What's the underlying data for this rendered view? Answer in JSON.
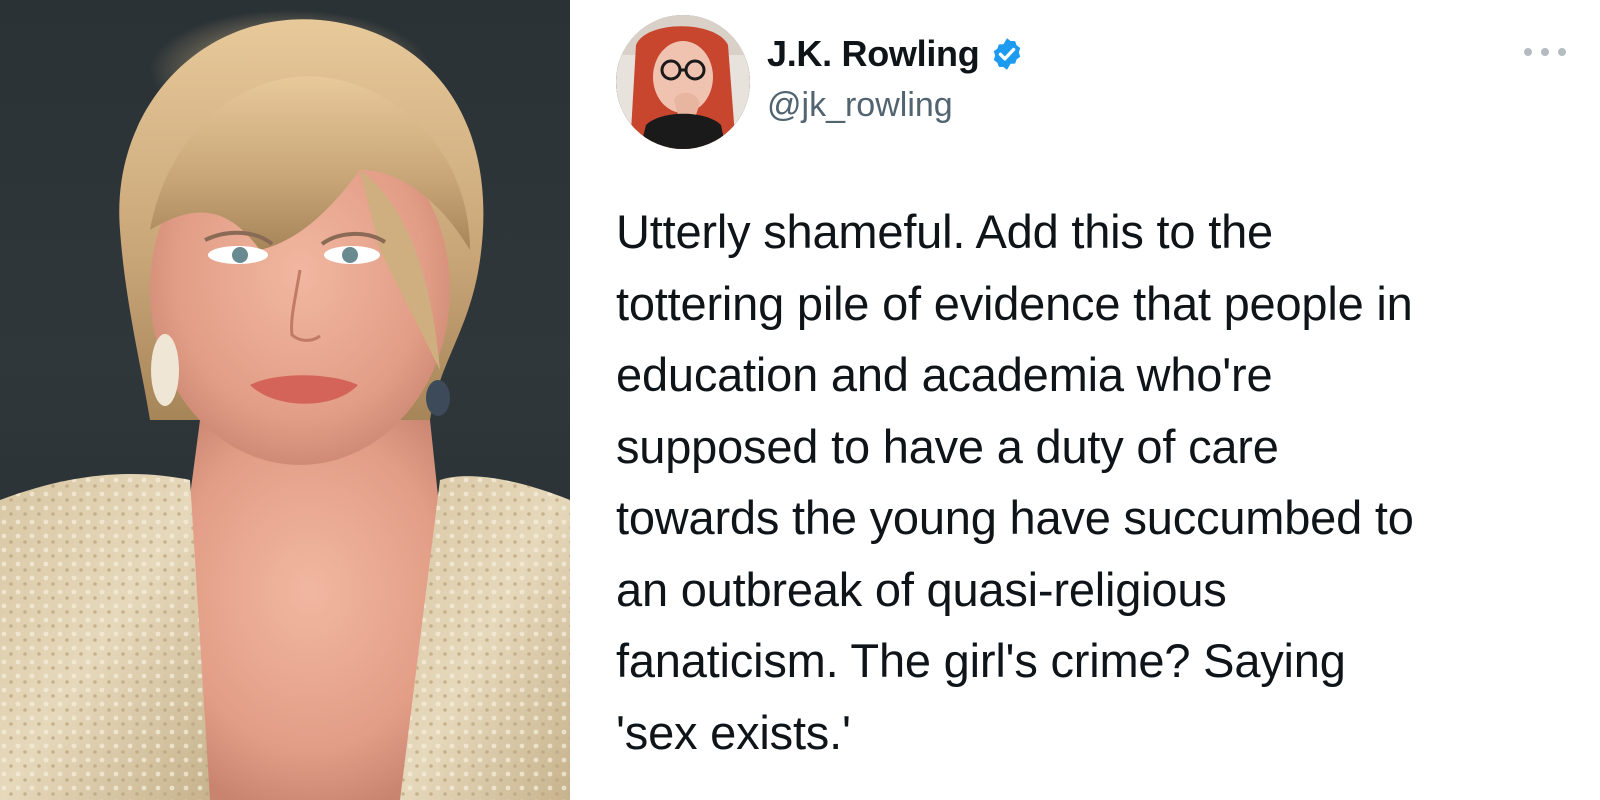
{
  "tweet": {
    "display_name": "J.K. Rowling",
    "handle": "@jk_rowling",
    "verified": true,
    "text": "Utterly shameful. Add this to the\ntottering pile of evidence that people in\neducation and academia who're\nsupposed to have a duty of care\ntowards the young have succumbed to\nan outbreak of quasi-religious\nfanaticism. The girl's crime? Saying\n'sex exists.'"
  },
  "icons": {
    "verified": "verified-badge-icon",
    "more": "more-options-icon"
  },
  "colors": {
    "name": "#0f1419",
    "handle": "#536471",
    "verified": "#1d9bf0",
    "more_dots": "#b4bcc2"
  }
}
